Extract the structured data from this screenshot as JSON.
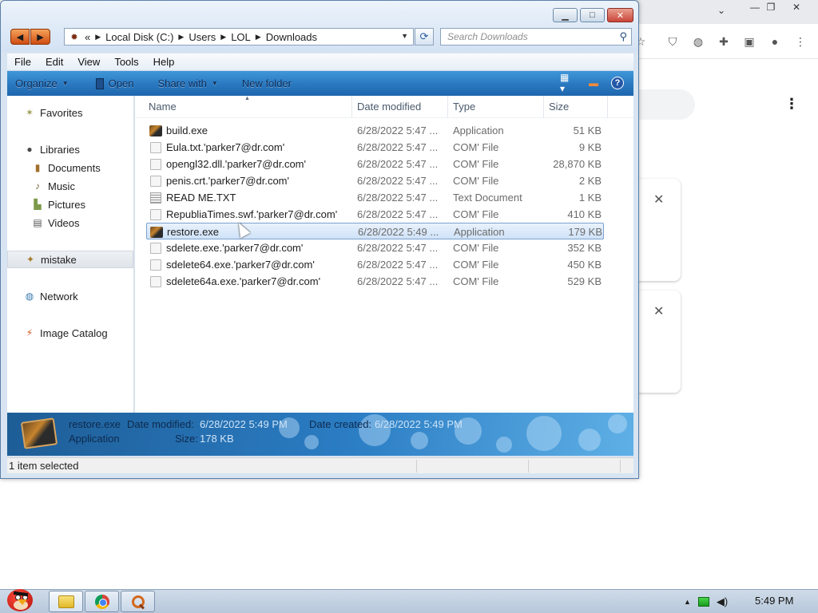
{
  "window": {
    "address": {
      "overflow_glyph": "«",
      "segments": [
        "Local Disk (C:)",
        "Users",
        "LOL",
        "Downloads"
      ]
    },
    "search_placeholder": "Search Downloads",
    "menu": [
      "File",
      "Edit",
      "View",
      "Tools",
      "Help"
    ],
    "command_bar": {
      "organize": "Organize",
      "open": "Open",
      "share_with": "Share with",
      "new_folder": "New folder"
    },
    "nav_pane": {
      "favorites": "Favorites",
      "libraries": "Libraries",
      "documents": "Documents",
      "music": "Music",
      "pictures": "Pictures",
      "videos": "Videos",
      "homegroup": "mistake",
      "network": "Network",
      "image_catalog": "Image Catalog"
    },
    "columns": {
      "name": "Name",
      "date": "Date modified",
      "type": "Type",
      "size": "Size"
    },
    "files": [
      {
        "name": "build.exe",
        "date": "6/28/2022 5:47 ...",
        "type": "Application",
        "size": "51 KB",
        "icon": "exe"
      },
      {
        "name": "Eula.txt.'parker7@dr.com'",
        "date": "6/28/2022 5:47 ...",
        "type": "COM' File",
        "size": "9 KB",
        "icon": "file"
      },
      {
        "name": "opengl32.dll.'parker7@dr.com'",
        "date": "6/28/2022 5:47 ...",
        "type": "COM' File",
        "size": "28,870 KB",
        "icon": "file"
      },
      {
        "name": "penis.crt.'parker7@dr.com'",
        "date": "6/28/2022 5:47 ...",
        "type": "COM' File",
        "size": "2 KB",
        "icon": "file"
      },
      {
        "name": "READ ME.TXT",
        "date": "6/28/2022 5:47 ...",
        "type": "Text Document",
        "size": "1 KB",
        "icon": "txt"
      },
      {
        "name": "RepubliaTimes.swf.'parker7@dr.com'",
        "date": "6/28/2022 5:47 ...",
        "type": "COM' File",
        "size": "410 KB",
        "icon": "file"
      },
      {
        "name": "restore.exe",
        "date": "6/28/2022 5:49 ...",
        "type": "Application",
        "size": "179 KB",
        "icon": "exe",
        "selected": true
      },
      {
        "name": "sdelete.exe.'parker7@dr.com'",
        "date": "6/28/2022 5:47 ...",
        "type": "COM' File",
        "size": "352 KB",
        "icon": "file"
      },
      {
        "name": "sdelete64.exe.'parker7@dr.com'",
        "date": "6/28/2022 5:47 ...",
        "type": "COM' File",
        "size": "450 KB",
        "icon": "file"
      },
      {
        "name": "sdelete64a.exe.'parker7@dr.com'",
        "date": "6/28/2022 5:47 ...",
        "type": "COM' File",
        "size": "529 KB",
        "icon": "file"
      }
    ],
    "details": {
      "name": "restore.exe",
      "type": "Application",
      "modified_label": "Date modified:",
      "modified_value": "6/28/2022 5:49 PM",
      "created_label": "Date created:",
      "created_value": "6/28/2022 5:49 PM",
      "size_label": "Size:",
      "size_value": "178 KB"
    },
    "status": "1 item selected"
  },
  "taskbar": {
    "clock": "5:49 PM"
  },
  "colors": {
    "command_bar": "#2a78c0",
    "selection": "#cfe2f8",
    "close_button": "#c9453a",
    "nav_arrows": "#e2661d"
  }
}
